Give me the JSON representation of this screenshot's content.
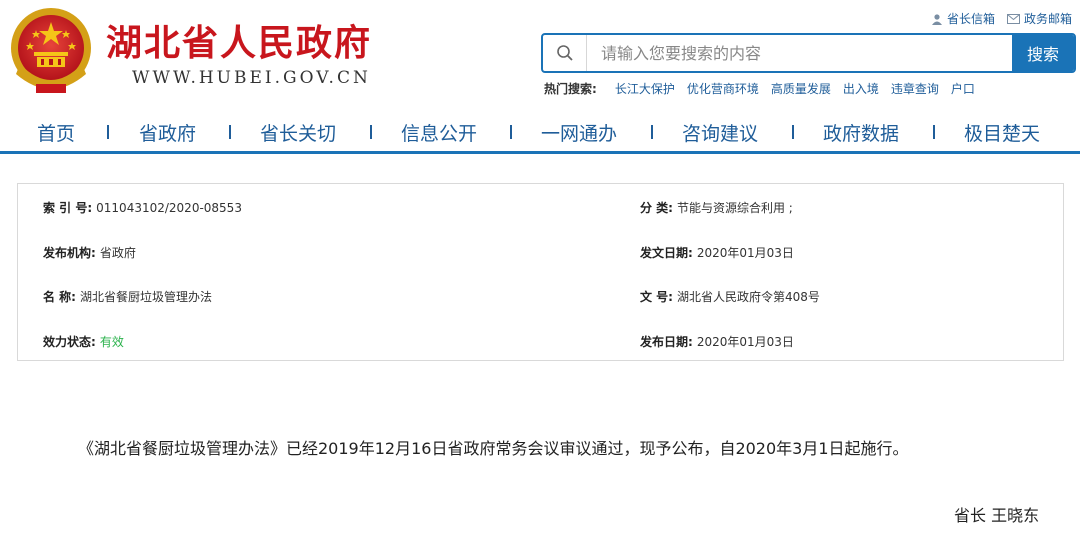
{
  "header": {
    "site_title": "湖北省人民政府",
    "site_url": "WWW.HUBEI.GOV.CN",
    "emblem_icon": "national-emblem-icon",
    "top_links": [
      {
        "label": "省长信箱",
        "icon": "person-icon"
      },
      {
        "label": "政务邮箱",
        "icon": "mail-icon"
      }
    ]
  },
  "search": {
    "placeholder": "请输入您要搜索的内容",
    "value": "",
    "button_label": "搜索",
    "hot_label": "热门搜索:",
    "hot_items": [
      "长江大保护",
      "优化营商环境",
      "高质量发展",
      "出入境",
      "违章查询",
      "户口"
    ]
  },
  "nav": {
    "items": [
      "首页",
      "省政府",
      "省长关切",
      "信息公开",
      "一网通办",
      "咨询建议",
      "政府数据",
      "极目楚天"
    ]
  },
  "info": {
    "index_label": "索 引 号:",
    "index_value": "011043102/2020-08553",
    "category_label": "分  类:",
    "category_value": "节能与资源综合利用 ;",
    "org_label": "发布机构:",
    "org_value": "省政府",
    "issue_date_label": "发文日期:",
    "issue_date_value": "2020年01月03日",
    "name_label": "名  称:",
    "name_value": "湖北省餐厨垃圾管理办法",
    "doc_no_label": "文  号:",
    "doc_no_value": "湖北省人民政府令第408号",
    "status_label": "效力状态:",
    "status_value": "有效",
    "publish_date_label": "发布日期:",
    "publish_date_value": "2020年01月03日"
  },
  "content": {
    "paragraph": "《湖北省餐厨垃圾管理办法》已经2019年12月16日省政府常务会议审议通过，现予公布，自2020年3月1日起施行。",
    "signature": "省长 王晓东"
  },
  "colors": {
    "brand_red": "#c8161d",
    "brand_blue": "#1a73b7",
    "link_blue": "#1f5d99",
    "valid_green": "#2bb24c"
  }
}
